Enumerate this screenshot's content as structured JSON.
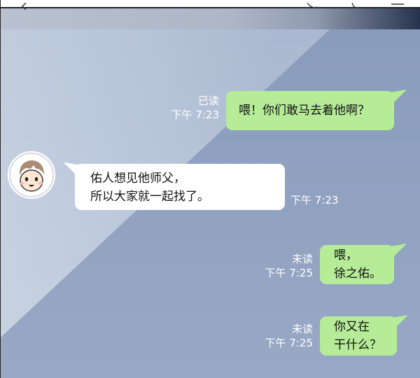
{
  "messages": [
    {
      "side": "out",
      "text_lines": [
        "喂！你们敢马去着他啊？"
      ],
      "status": "已读",
      "time": "下午 7:23"
    },
    {
      "side": "in",
      "text_lines": [
        "佑人想见他师父，",
        "所以大家就一起找了。"
      ],
      "time": "下午 7:23"
    },
    {
      "side": "out",
      "text_lines": [
        "喂，",
        "徐之佑。"
      ],
      "status": "未读",
      "time": "下午 7:25"
    },
    {
      "side": "out",
      "text_lines": [
        "你又在",
        "干什么？"
      ],
      "status": "未读",
      "time": "下午 7:25"
    }
  ],
  "colors": {
    "outgoing_bubble": "#b6ec98",
    "incoming_bubble": "#ffffff",
    "chat_bg": "#8a9cbd"
  },
  "icons": {
    "contact_avatar": "boy-avatar-icon"
  }
}
